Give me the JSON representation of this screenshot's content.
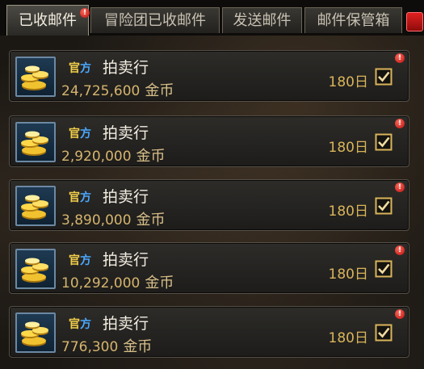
{
  "tabs": [
    {
      "label": "已收邮件",
      "active": true,
      "has_alert": true
    },
    {
      "label": "冒险团已收邮件",
      "active": false
    },
    {
      "label": "发送邮件",
      "active": false
    },
    {
      "label": "邮件保管箱",
      "active": false
    }
  ],
  "tab_alert_glyph": "!",
  "colors": {
    "gold_text": "#d6b46e",
    "official_gold": "#f3cf4a",
    "official_blue": "#4aa8ff",
    "alert_red": "#c8140f"
  },
  "mails": [
    {
      "official_a": "官",
      "official_b": "方",
      "sender": "拍卖行",
      "amount": "24,725,600",
      "unit": "金币",
      "days": "180日",
      "checked": true,
      "alert": "!",
      "icon": "gold-coins-icon"
    },
    {
      "official_a": "官",
      "official_b": "方",
      "sender": "拍卖行",
      "amount": "2,920,000",
      "unit": "金币",
      "days": "180日",
      "checked": true,
      "alert": "!",
      "icon": "gold-coins-icon"
    },
    {
      "official_a": "官",
      "official_b": "方",
      "sender": "拍卖行",
      "amount": "3,890,000",
      "unit": "金币",
      "days": "180日",
      "checked": true,
      "alert": "!",
      "icon": "gold-coins-icon"
    },
    {
      "official_a": "官",
      "official_b": "方",
      "sender": "拍卖行",
      "amount": "10,292,000",
      "unit": "金币",
      "days": "180日",
      "checked": true,
      "alert": "!",
      "icon": "gold-coins-icon"
    },
    {
      "official_a": "官",
      "official_b": "方",
      "sender": "拍卖行",
      "amount": "776,300",
      "unit": "金币",
      "days": "180日",
      "checked": true,
      "alert": "!",
      "icon": "gold-coins-icon"
    }
  ]
}
